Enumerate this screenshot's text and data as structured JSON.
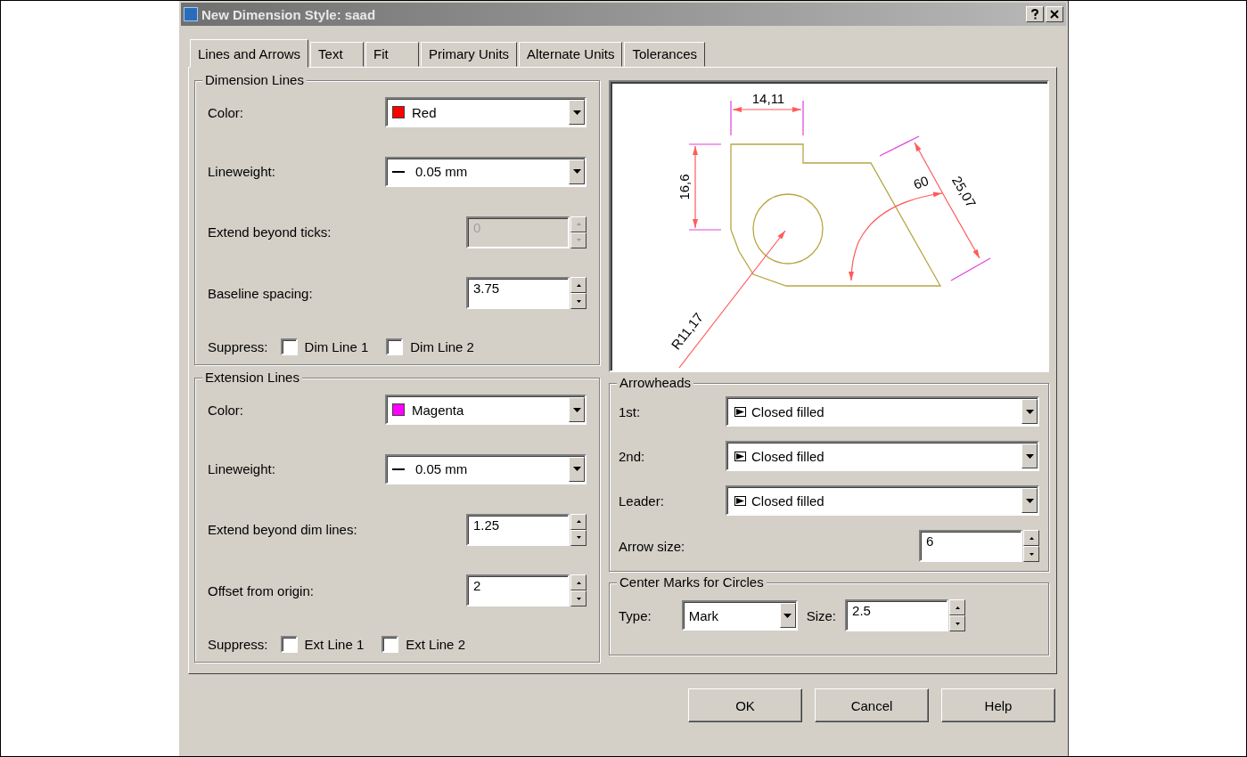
{
  "window": {
    "title": "New Dimension Style: saad"
  },
  "tabs": [
    {
      "label": "Lines and Arrows",
      "selected": true
    },
    {
      "label": "Text",
      "selected": false
    },
    {
      "label": "Fit",
      "selected": false
    },
    {
      "label": "Primary Units",
      "selected": false
    },
    {
      "label": "Alternate Units",
      "selected": false
    },
    {
      "label": "Tolerances",
      "selected": false
    }
  ],
  "dimension_lines": {
    "title": "Dimension Lines",
    "rows": [
      {
        "kind": "color",
        "label": "Color:",
        "value": "Red",
        "color": "#ff0000"
      },
      {
        "kind": "lineweight",
        "label": "Lineweight:",
        "value": "0.05 mm"
      },
      {
        "kind": "spinner",
        "label": "Extend beyond ticks:",
        "value": "0",
        "disabled": true
      },
      {
        "kind": "spinner",
        "label": "Baseline spacing:",
        "value": "3.75",
        "disabled": false
      },
      {
        "kind": "suppress",
        "label": "Suppress:",
        "checks": [
          {
            "label": "Dim Line 1",
            "checked": false
          },
          {
            "label": "Dim Line 2",
            "checked": false
          }
        ]
      }
    ]
  },
  "extension_lines": {
    "title": "Extension Lines",
    "rows": [
      {
        "kind": "color",
        "label": "Color:",
        "value": "Magenta",
        "color": "#ff00ff"
      },
      {
        "kind": "lineweight",
        "label": "Lineweight:",
        "value": "0.05 mm"
      },
      {
        "kind": "spinner",
        "label": "Extend beyond dim lines:",
        "value": "1.25",
        "disabled": false
      },
      {
        "kind": "spinner",
        "label": "Offset from origin:",
        "value": "2",
        "disabled": false
      },
      {
        "kind": "suppress",
        "label": "Suppress:",
        "checks": [
          {
            "label": "Ext Line 1",
            "checked": false
          },
          {
            "label": "Ext Line 2",
            "checked": false
          }
        ]
      }
    ]
  },
  "preview": {
    "horizontal": "14,11",
    "vertical": "16,6",
    "angular": "60",
    "aligned": "25,07",
    "radius": "R11,17"
  },
  "arrowheads": {
    "title": "Arrowheads",
    "rows": [
      {
        "label": "1st:",
        "value": "Closed filled"
      },
      {
        "label": "2nd:",
        "value": "Closed filled"
      },
      {
        "label": "Leader:",
        "value": "Closed filled"
      }
    ],
    "arrow_size": {
      "label": "Arrow size:",
      "value": "6"
    }
  },
  "center_marks": {
    "title": "Center Marks for Circles",
    "type": {
      "label": "Type:",
      "value": "Mark"
    },
    "size": {
      "label": "Size:",
      "value": "2.5"
    }
  },
  "buttons": [
    {
      "label": "OK"
    },
    {
      "label": "Cancel"
    },
    {
      "label": "Help"
    }
  ]
}
